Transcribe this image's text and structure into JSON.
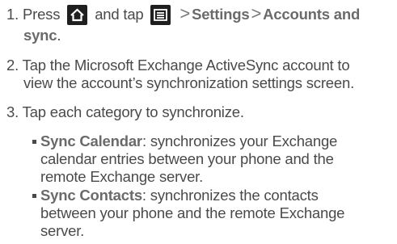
{
  "steps": [
    {
      "number": "1.",
      "text_press": "Press",
      "home_icon": "home-icon",
      "text_and_tap": "and tap",
      "menu_icon": "menu-icon",
      "sep1": ">",
      "settings": "Settings",
      "sep2": ">",
      "accounts": "Accounts and",
      "accounts_cont": "sync",
      "period": "."
    },
    {
      "number": "2.",
      "line1": "Tap the Microsoft Exchange ActiveSync account to",
      "line2": "view the account’s synchronization settings screen."
    },
    {
      "number": "3.",
      "line1": "Tap each category to synchronize."
    }
  ],
  "bullets": [
    {
      "label": "Sync Calendar",
      "line1_rest": ": synchronizes your Exchange",
      "line2": "calendar entries between your phone and the",
      "line3": "remote Exchange server."
    },
    {
      "label": "Sync Contacts",
      "line1_rest": ": synchronizes the contacts",
      "line2": "between your phone and the remote Exchange",
      "line3": "server."
    }
  ],
  "colors": {
    "text": "#4a4a4a",
    "bold": "#6a6a6a",
    "icon_bg": "#1f1f1f"
  }
}
